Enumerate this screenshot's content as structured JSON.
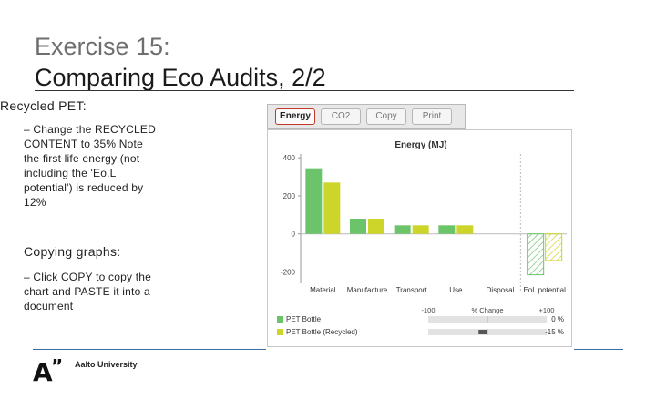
{
  "slide": {
    "title_line1": "Exercise 15:",
    "title_line2": "Comparing Eco Audits, 2/2",
    "section1": "Recycled PET:",
    "bullet1_lines": [
      "– Change the RECYCLED",
      "CONTENT to 35% Note",
      "the first life energy (not",
      "including the 'Eo.L",
      "potential') is reduced by",
      "12%"
    ],
    "section2": "Copying graphs:",
    "bullet2_lines": [
      "– Click COPY to copy the",
      "chart and PASTE it into a",
      "document"
    ],
    "logo_mark": "A",
    "logo_quote": "”",
    "logo_text": "Aalto University"
  },
  "toolbar": {
    "buttons": [
      {
        "label": "Energy",
        "active": true
      },
      {
        "label": "CO2",
        "active": false
      },
      {
        "label": "Copy",
        "active": false
      },
      {
        "label": "Print",
        "active": false
      }
    ]
  },
  "chart_data": {
    "type": "bar",
    "title": "Energy (MJ)",
    "categories": [
      "Material",
      "Manufacture",
      "Transport",
      "Use",
      "Disposal",
      "EoL potential"
    ],
    "series": [
      {
        "name": "PET Bottle",
        "color": "#6cc46a",
        "values": [
          345,
          80,
          45,
          45,
          0,
          -215
        ]
      },
      {
        "name": "PET Bottle (Recycled)",
        "color": "#cdd42a",
        "values": [
          270,
          80,
          45,
          45,
          0,
          -140
        ]
      }
    ],
    "hatched_categories": [
      "EoL potential"
    ],
    "yticks": [
      400,
      200,
      0,
      -200
    ],
    "ylim": [
      -260,
      420
    ],
    "change_header": {
      "left": "-100",
      "center": "% Change",
      "right": "+100"
    },
    "change_values": [
      "0 %",
      "-15 %"
    ],
    "change_fraction": [
      0,
      -0.15
    ]
  }
}
